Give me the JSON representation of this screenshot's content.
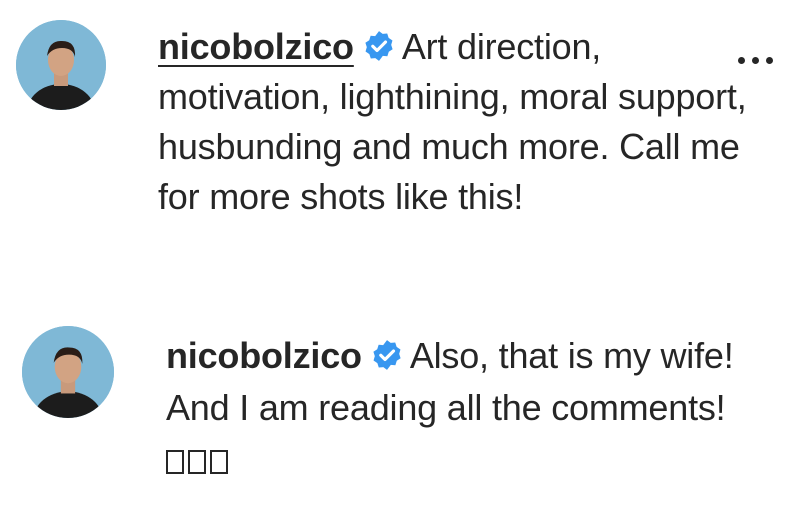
{
  "comments": [
    {
      "username": "nicobolzico",
      "verified": true,
      "avatar": "profile-photo",
      "text": "Art direction, motivation, lighthining, moral support, husbunding and much more. Call me for more shots like this!",
      "has_more_menu": true
    },
    {
      "username": "nicobolzico",
      "verified": true,
      "avatar": "profile-photo",
      "text": "Also, that is my wife! And I am reading all the comments!",
      "emoji_placeholders": [
        "□",
        "□",
        "□"
      ],
      "has_more_menu": false
    }
  ],
  "icons": {
    "verified": "verified-badge-icon",
    "more": "more-options-icon"
  },
  "colors": {
    "text": "#262626",
    "verified_badge": "#3897f0",
    "avatar_bg": "#7fb8d6"
  }
}
